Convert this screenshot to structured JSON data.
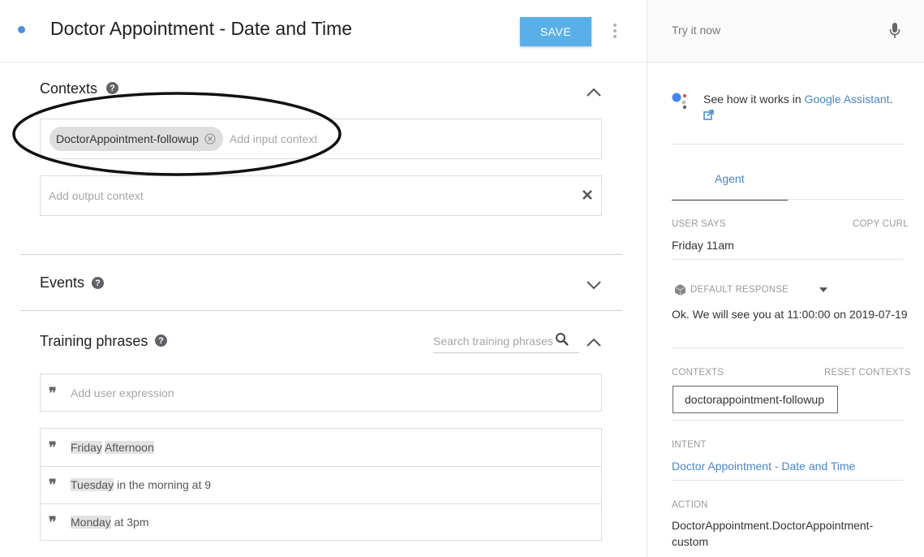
{
  "header": {
    "title": "Doctor Appointment - Date and Time",
    "save_label": "SAVE"
  },
  "contexts": {
    "title": "Contexts",
    "input_chip": "DoctorAppointment-followup",
    "input_placeholder": "Add input context",
    "output_placeholder": "Add output context"
  },
  "events": {
    "title": "Events"
  },
  "training": {
    "title": "Training phrases",
    "search_placeholder": "Search training phrases",
    "add_placeholder": "Add user expression",
    "phrases": [
      {
        "entity": "Friday",
        "rest": "Afternoon",
        "rest_highlighted": true
      },
      {
        "entity": "Tuesday",
        "rest": "in the morning at 9",
        "rest_highlighted": false
      },
      {
        "entity": "Monday",
        "rest": "at 3pm",
        "rest_highlighted": false
      }
    ]
  },
  "console": {
    "try_placeholder": "Try it now",
    "assistant_text": "See how it works in ",
    "assistant_link": "Google Assistant",
    "assistant_period": ".",
    "tab_agent": "Agent",
    "user_says_label": "USER SAYS",
    "copy_curl_label": "COPY CURL",
    "user_says_value": "Friday 11am",
    "default_response_label": "DEFAULT RESPONSE",
    "default_response_value": "Ok. We will see you at 11:00:00 on 2019-07-19",
    "contexts_label": "CONTEXTS",
    "reset_contexts_label": "RESET CONTEXTS",
    "context_value": "doctorappointment-followup",
    "intent_label": "INTENT",
    "intent_value": "Doctor Appointment - Date and Time",
    "action_label": "ACTION",
    "action_value_line1": "DoctorAppointment.DoctorAppointment-",
    "action_value_line2": "custom"
  },
  "colors": {
    "accent": "#5aafe8",
    "link": "#4a86c5",
    "annotation_ellipse": "#111111"
  },
  "icons": [
    "status-dot-icon",
    "more-vert-icon",
    "help-icon",
    "chevron-up-icon",
    "chevron-down-icon",
    "close-icon",
    "search-icon",
    "quote-icon",
    "mic-icon",
    "google-assistant-icon",
    "external-link-icon",
    "dropdown-arrow-icon",
    "response-cube-icon"
  ]
}
